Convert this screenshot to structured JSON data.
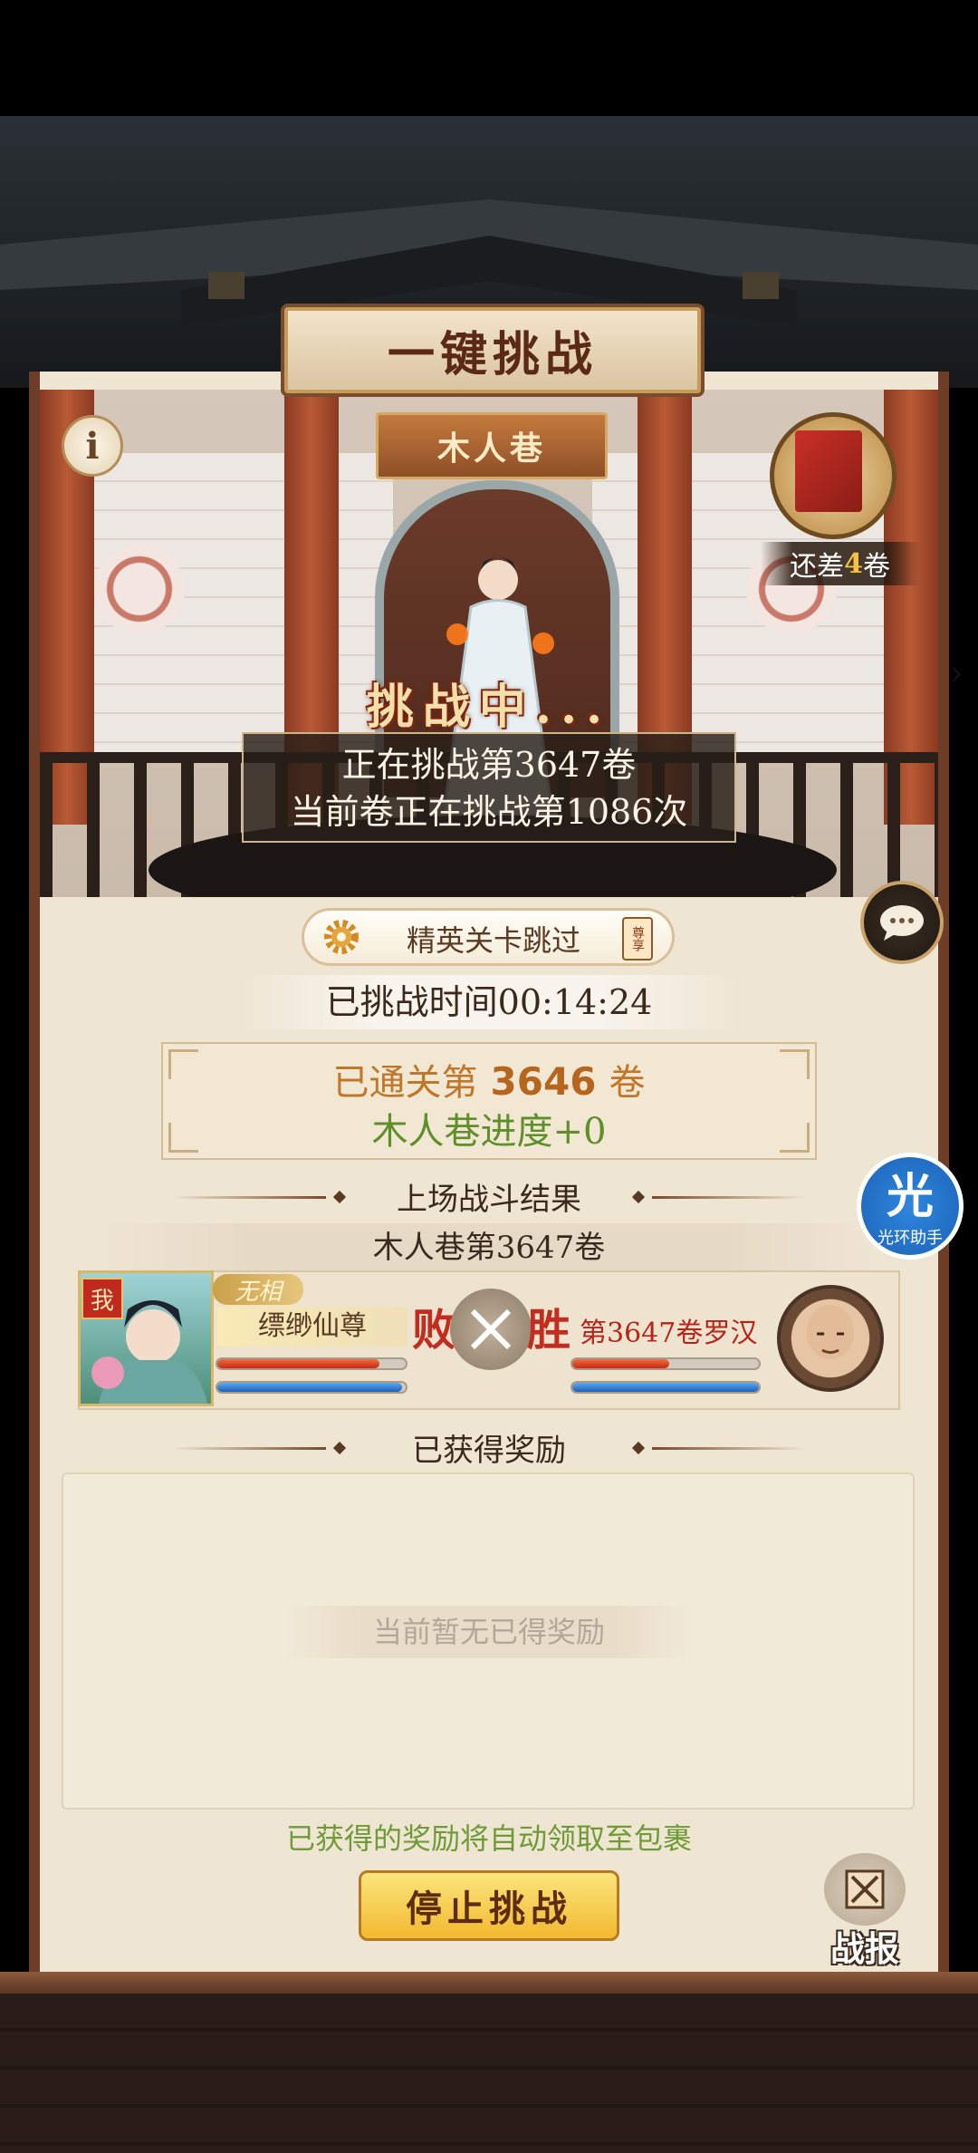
{
  "header": {
    "title": "一键挑战"
  },
  "scene": {
    "stage_name": "木人巷",
    "book_remaining_prefix": "还差",
    "book_remaining_count": "4",
    "book_remaining_suffix": "卷",
    "status_title": "挑战中...",
    "challenge_line1": "正在挑战第3647卷",
    "challenge_line2": "当前卷正在挑战第1086次"
  },
  "controls": {
    "elite_skip_label": "精英关卡跳过",
    "elite_skip_badge": "尊享",
    "info_icon_glyph": "i"
  },
  "elapsed": "已挑战时间00:14:24",
  "cleared": {
    "prefix": "已通关第",
    "number": "3646",
    "suffix": "卷",
    "progress": "木人巷进度+0"
  },
  "last_battle": {
    "section_title": "上场战斗结果",
    "stage_title": "木人巷第3647卷",
    "player": {
      "tag": "我",
      "nature": "无相",
      "name": "缥缈仙尊",
      "hp": 0.86,
      "mp": 0.98
    },
    "player_result": "败",
    "enemy_result": "胜",
    "enemy": {
      "name": "第3647卷罗汉",
      "hp": 0.52,
      "mp": 1.0
    }
  },
  "rewards": {
    "section_title": "已获得奖励",
    "empty_text": "当前暂无已得奖励",
    "auto_claim_note": "已获得的奖励将自动领取至包裹"
  },
  "actions": {
    "stop_label": "停止挑战",
    "report_label": "战报"
  },
  "assistant": {
    "main": "光",
    "sub": "光环助手"
  },
  "colors": {
    "accent_gold": "#f3b931",
    "lose_win_red": "#c22d20",
    "progress_green": "#6f9b36"
  }
}
